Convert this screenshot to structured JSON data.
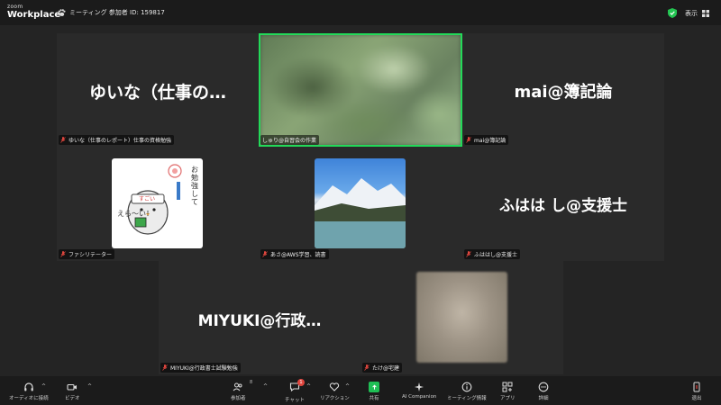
{
  "topbar": {
    "brand_small": "zoom",
    "brand": "Workplace",
    "meeting_label": "ミーティング 参加者 ID: 159817",
    "view_label": "表示"
  },
  "tiles": [
    {
      "big_name": "ゆいな（仕事の…",
      "label": "ゆいな（仕事のレポート）仕事の資格勉強"
    },
    {
      "big_name": "",
      "label": "しゅり@自習会の作業",
      "active": true
    },
    {
      "big_name": "mai@簿記論",
      "label": "mai@簿記論"
    },
    {
      "big_name": "",
      "label": "ファシリテーター"
    },
    {
      "big_name": "",
      "label": "あさ@AWS学習、読書"
    },
    {
      "big_name": "ふはは し@支援士",
      "label": "ふははし@支援士"
    },
    {
      "big_name": "MIYUKI@行政…",
      "label": "MIYUKI@行政書士試験勉強"
    },
    {
      "big_name": "",
      "label": "たけ@宅建"
    }
  ],
  "sticker": {
    "text_right": "お勉強して",
    "text_left": "えら〜い！",
    "badge": "すごい"
  },
  "toolbar": {
    "audio": "オーディオに接続",
    "video": "ビデオ",
    "participants": "参加者",
    "participants_count": "8",
    "chat": "チャット",
    "chat_badge": "1",
    "reactions": "リアクション",
    "share": "共有",
    "ai": "AI Companion",
    "info": "ミーティング情報",
    "apps": "アプリ",
    "more": "詳細",
    "leave": "退出"
  },
  "colors": {
    "active_speaker": "#23d959",
    "share_green": "#1fbf55",
    "mute_red": "#e0463e"
  }
}
